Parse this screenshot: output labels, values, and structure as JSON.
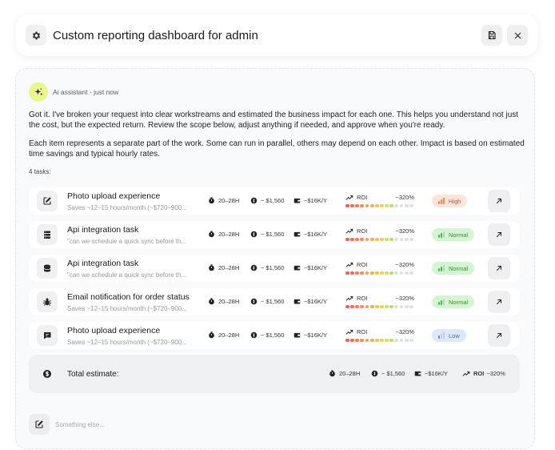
{
  "header": {
    "title": "Custom reporting dashboard for admin",
    "icon": "gear-icon"
  },
  "meta": {
    "author": "Ai assistant",
    "separator": "·",
    "time": "just now"
  },
  "message": {
    "p1": "Got it. I've broken your request into clear workstreams and estimated the business impact for each one. This helps you understand not just the cost, but the expected return. Review the scope below, adjust anything if needed, and approve when you're ready.",
    "p2": "Each item represents a separate part of the work. Some can run in parallel, others may depend on each other. Impact is based on estimated time savings and typical hourly rates."
  },
  "tasks_label": "4 tasks:",
  "tasks": [
    {
      "icon": "edit-icon",
      "name": "Photo upload experience",
      "sub": "Saves ~12–15 hours/month (~$720–900...",
      "hours": "20–28H",
      "cost": "~ $1,560",
      "impact": "~$16K/Y",
      "roi_label": "ROI",
      "roi_value": "~320%",
      "roi_fill": 0.7,
      "priority": "High"
    },
    {
      "icon": "server-icon",
      "name": "Api integration task",
      "sub": "\"can we schedule a quick sync before th...",
      "hours": "20–28H",
      "cost": "~ $1,560",
      "impact": "~$16K/Y",
      "roi_label": "ROI",
      "roi_value": "~320%",
      "roi_fill": 0.7,
      "priority": "Normal"
    },
    {
      "icon": "database-icon",
      "name": "Api integration task",
      "sub": "\"can we schedule a quick sync before th...",
      "hours": "20–28H",
      "cost": "~ $1,560",
      "impact": "~$16K/Y",
      "roi_label": "ROI",
      "roi_value": "~320%",
      "roi_fill": 0.7,
      "priority": "Normal"
    },
    {
      "icon": "bug-icon",
      "name": "Email notification for order status",
      "sub": "Saves ~12–15 hours/month (~$720–900...",
      "hours": "20–28H",
      "cost": "~ $1,560",
      "impact": "~$16K/Y",
      "roi_label": "ROI",
      "roi_value": "~320%",
      "roi_fill": 0.7,
      "priority": "Normal"
    },
    {
      "icon": "message-icon",
      "name": "Photo upload experience",
      "sub": "Saves ~12–15 hours/month (~$720–900...",
      "hours": "20–28H",
      "cost": "~ $1,560",
      "impact": "~$16K/Y",
      "roi_label": "ROI",
      "roi_value": "~320%",
      "roi_fill": 0.7,
      "priority": "Low"
    }
  ],
  "priority_styles": {
    "High": {
      "bg": "#fde4dc",
      "fg": "#c0552f",
      "bar": "#f08a3c",
      "level": 3
    },
    "Normal": {
      "bg": "#d4f5d1",
      "fg": "#3a8a3a",
      "bar": "#3fbf4a",
      "level": 2
    },
    "Low": {
      "bg": "#dde8fb",
      "fg": "#3f6fb8",
      "bar": "#5b8fe6",
      "level": 1
    }
  },
  "total": {
    "label": "Total estimate:",
    "hours": "20–28H",
    "cost": "~ $1,560",
    "impact": "~$16K/Y",
    "roi_label": "ROI",
    "roi_value": "~320%"
  },
  "compose": {
    "placeholder": "Something else..."
  }
}
